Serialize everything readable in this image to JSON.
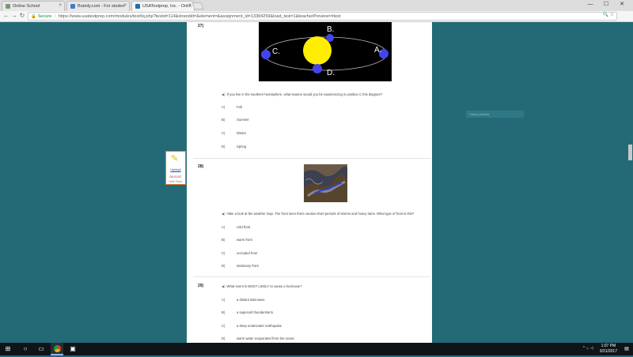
{
  "browser": {
    "tabs": [
      {
        "title": "Online School",
        "color": "#7a9a7a"
      },
      {
        "title": "Brainly.com - For studen",
        "color": "#4a78c8"
      },
      {
        "title": "USATestprep, Inc. - Onlin",
        "color": "#1a6fb5"
      }
    ],
    "secure_label": "Secure",
    "url": "https://www.usatestprep.com/modules/test/tq.php?testid=114&strandid=&element=&assignment_id=13384259&load_test=1&teacherPreview=#test",
    "window_controls": [
      "—",
      "☐",
      "✕"
    ]
  },
  "questions": [
    {
      "number": "27)",
      "text": "If you live in the southern hemisphere, what season would you be experiencing in position C this diagram?",
      "diagram_labels": [
        "A.",
        "B.",
        "C.",
        "D."
      ],
      "options": [
        {
          "letter": "A)",
          "text": "Fall"
        },
        {
          "letter": "B)",
          "text": "Summer"
        },
        {
          "letter": "C)",
          "text": "Winter"
        },
        {
          "letter": "D)",
          "text": "Spring"
        }
      ]
    },
    {
      "number": "28)",
      "text": "Take a look at the weather map. The front seen there causes short periods of storms and heavy rains. What type of front is this?",
      "options": [
        {
          "letter": "A)",
          "text": "cold front"
        },
        {
          "letter": "B)",
          "text": "warm front"
        },
        {
          "letter": "C)",
          "text": "occluded front"
        },
        {
          "letter": "D)",
          "text": "stationary front"
        }
      ]
    },
    {
      "number": "29)",
      "text": "What event is MOST LIKELY to cause a hurricane?",
      "options": [
        {
          "letter": "A)",
          "text": "a distant tidal wave"
        },
        {
          "letter": "B)",
          "text": "a supercell thunderstorm"
        },
        {
          "letter": "C)",
          "text": "a deep underwater earthquake"
        },
        {
          "letter": "D)",
          "text": "warm water evaporated from the ocean"
        }
      ]
    }
  ],
  "side_widget": {
    "highlight_label": "Highlight",
    "timer": "00:11:57",
    "hide_label": "Hide Timer"
  },
  "right_button": {
    "label": "Close preview"
  },
  "taskbar": {
    "time": "1:07 PM",
    "date": "3/31/2017"
  },
  "colors": {
    "page_bg": "#236a76",
    "sun": "#ffee00",
    "planet": "#4444ee"
  }
}
